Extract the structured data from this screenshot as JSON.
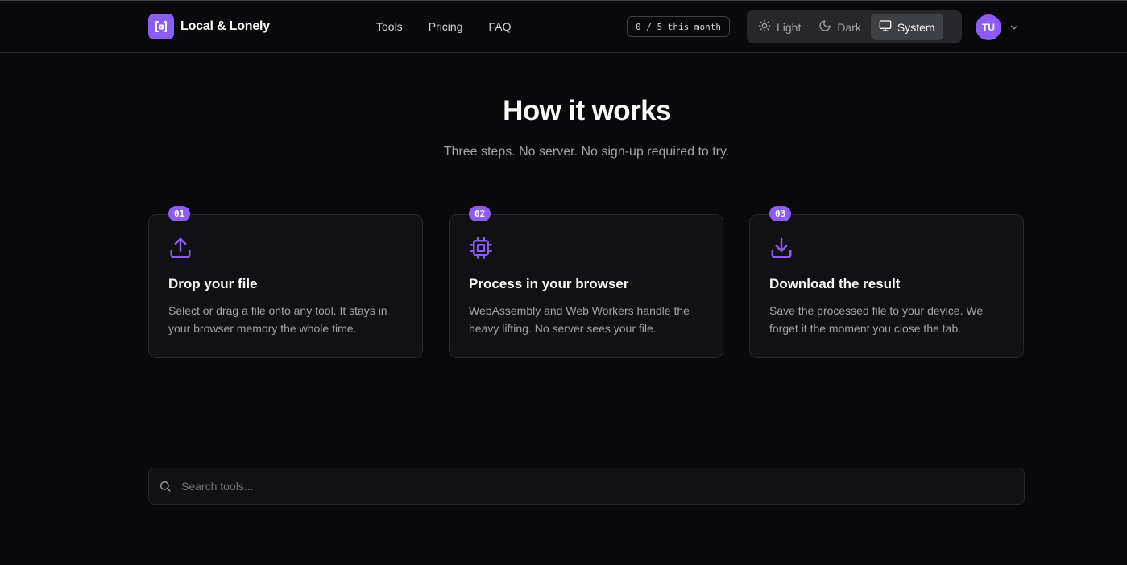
{
  "header": {
    "brand": "Local & Lonely",
    "nav": [
      "Tools",
      "Pricing",
      "FAQ"
    ],
    "usage": "0 / 5 this month",
    "theme": {
      "options": [
        {
          "label": "Light",
          "icon": "sun-icon"
        },
        {
          "label": "Dark",
          "icon": "moon-icon"
        },
        {
          "label": "System",
          "icon": "monitor-icon"
        }
      ],
      "selected": "System"
    },
    "avatar_initials": "TU"
  },
  "hero": {
    "title": "How it works",
    "subtitle": "Three steps. No server. No sign-up required to try."
  },
  "steps": [
    {
      "number": "01",
      "icon": "upload-icon",
      "title": "Drop your file",
      "description": "Select or drag a file onto any tool. It stays in your browser memory the whole time."
    },
    {
      "number": "02",
      "icon": "cpu-icon",
      "title": "Process in your browser",
      "description": "WebAssembly and Web Workers handle the heavy lifting. No server sees your file."
    },
    {
      "number": "03",
      "icon": "download-icon",
      "title": "Download the result",
      "description": "Save the processed file to your device. We forget it the moment you close the tab."
    }
  ],
  "search": {
    "placeholder": "Search tools...",
    "value": ""
  },
  "colors": {
    "accent": "#8b5cf6",
    "background": "#09090b",
    "card": "#111113",
    "border": "#27272a"
  }
}
